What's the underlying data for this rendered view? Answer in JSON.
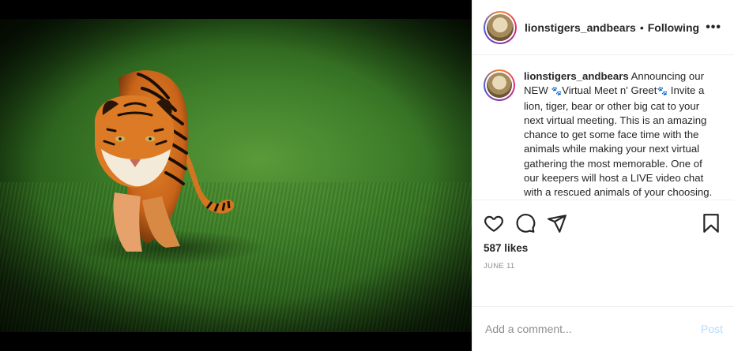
{
  "post": {
    "author": {
      "username": "lionstigers_andbears",
      "follow_status": "Following",
      "separator": "•"
    },
    "more_label": "•••",
    "media": {
      "subject": "tiger walking on grass"
    },
    "caption": {
      "username": "lionstigers_andbears",
      "part1": " Announcing our NEW ",
      "paw_emoji": "🐾",
      "part2": "Virtual Meet n' Greet",
      "part3": " Invite a lion, tiger, bear or other big cat to your next virtual meeting. This is an amazing chance to get some face time with the animals while making your next virtual gathering the most memorable. One of our keepers will host a LIVE video chat with a rescued animals of your choosing."
    },
    "actions": {
      "icons": [
        "heart-icon",
        "comment-icon",
        "share-icon",
        "bookmark-icon"
      ]
    },
    "likes_label": "587 likes",
    "date_label": "JUNE 11",
    "comment_box": {
      "placeholder": "Add a comment...",
      "value": "",
      "post_label": "Post"
    },
    "colors": {
      "post_button_disabled": "#b3dbff",
      "muted_text": "#8e8e8e",
      "text": "#262626",
      "divider": "#efefef"
    }
  }
}
